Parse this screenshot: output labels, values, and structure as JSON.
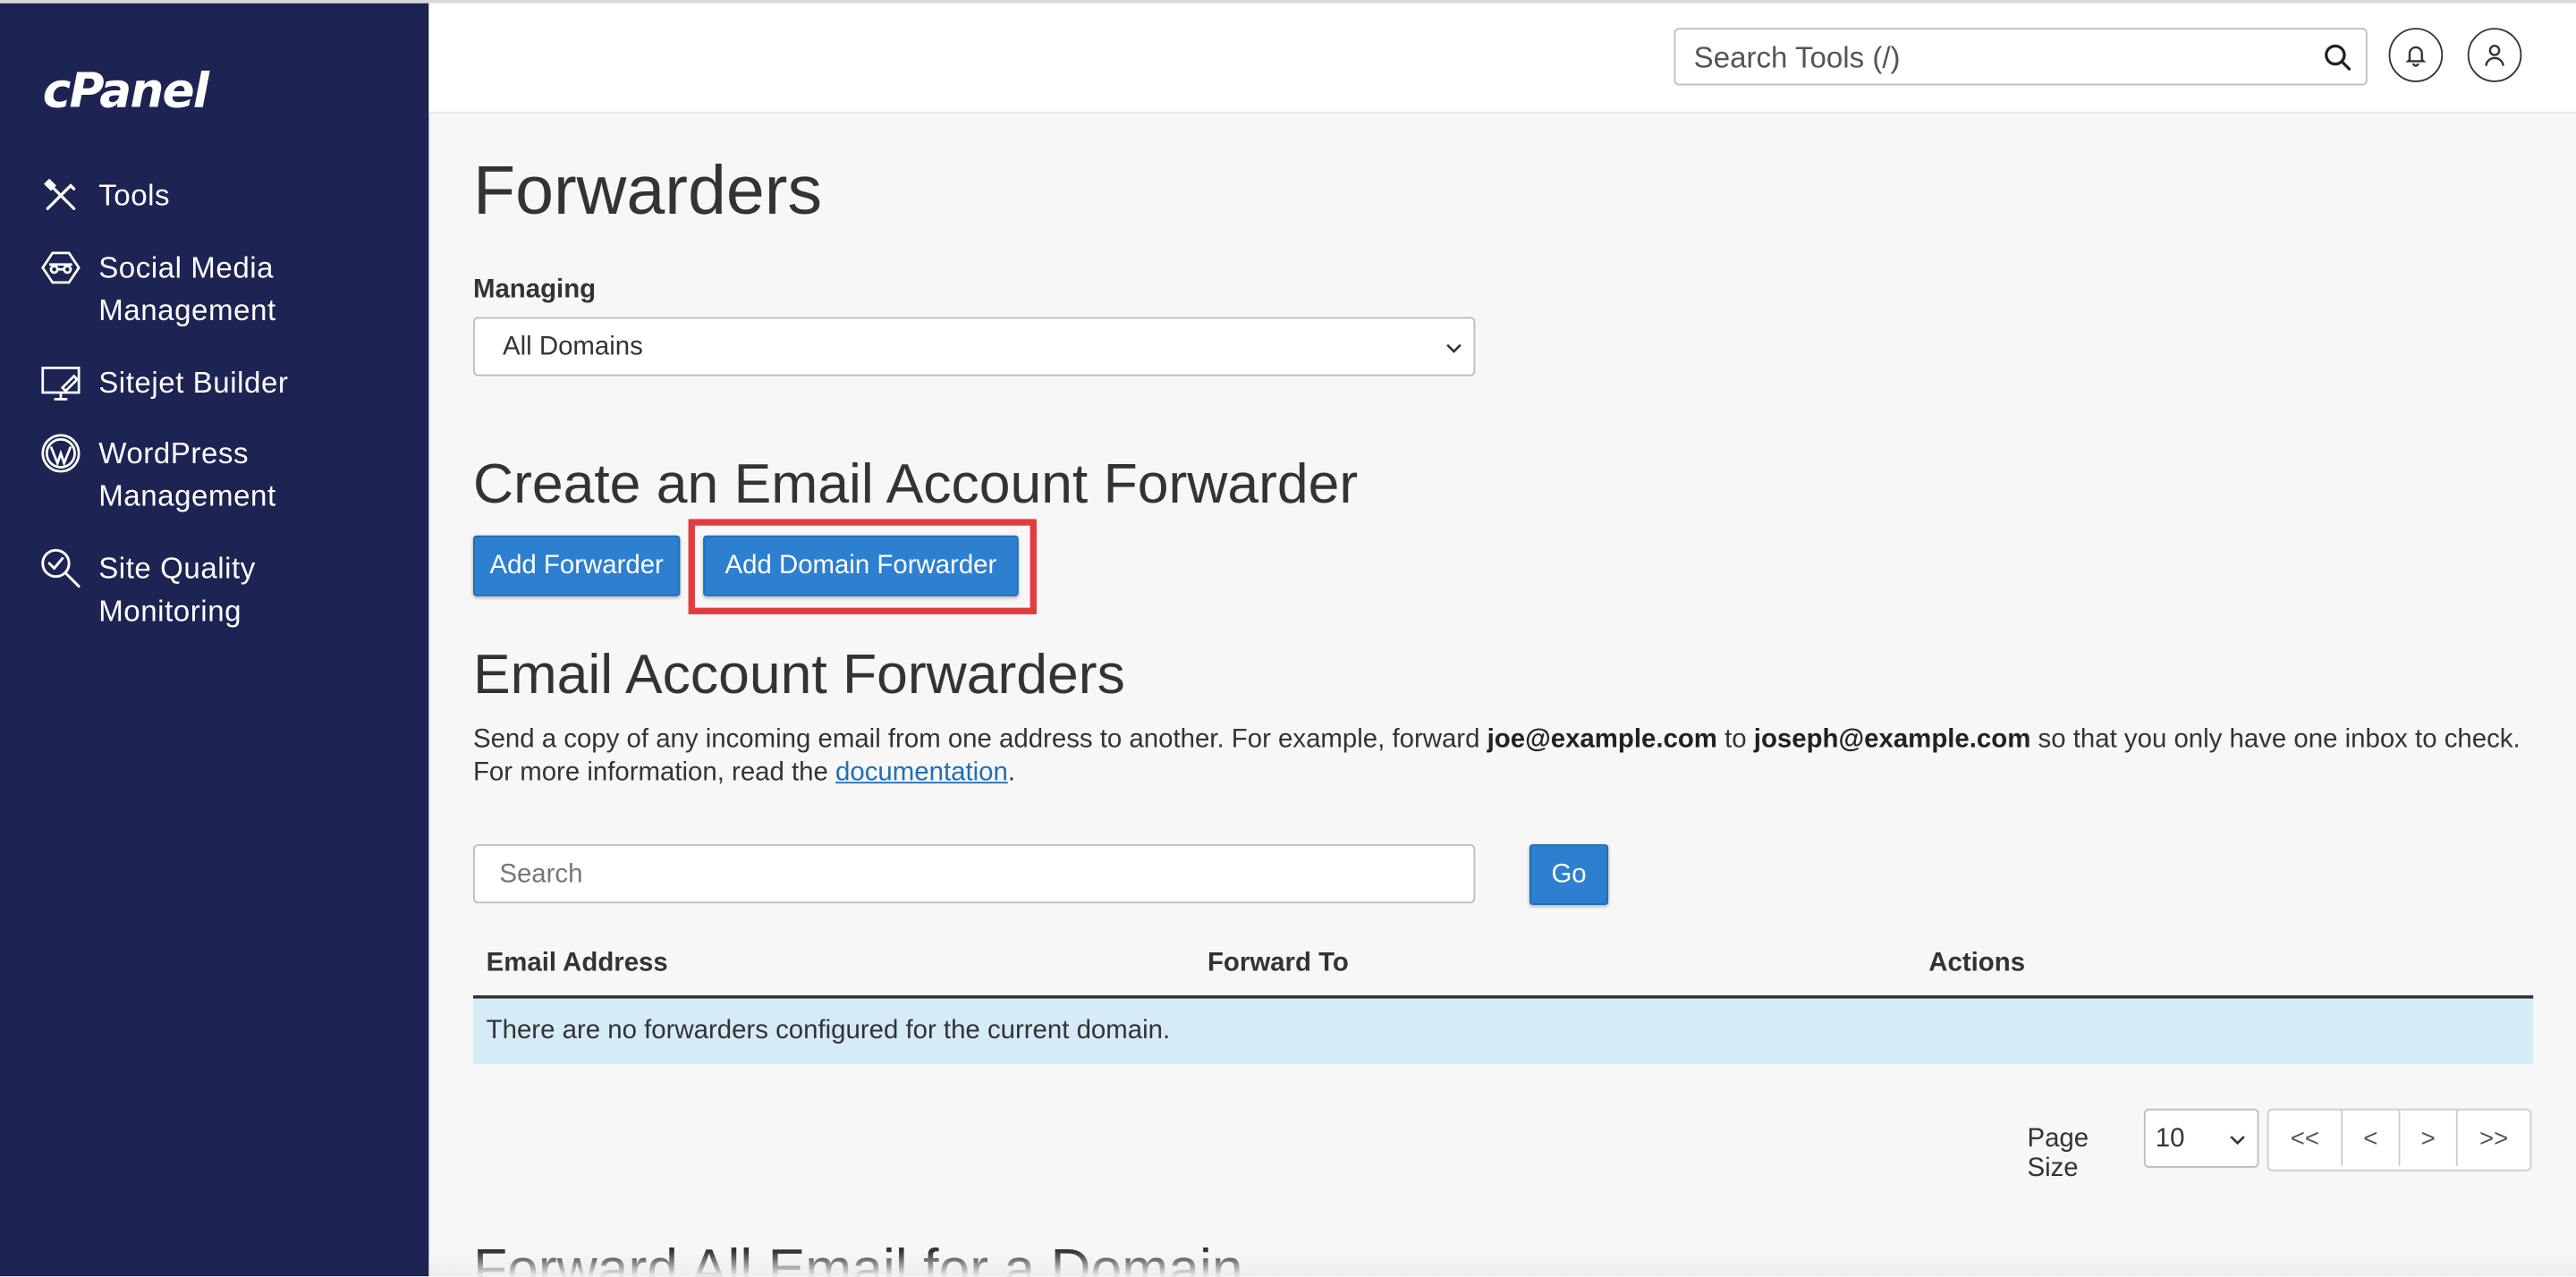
{
  "app": {
    "logo": "cPanel"
  },
  "sidebar": {
    "items": [
      {
        "label": "Tools",
        "icon": "tools-icon"
      },
      {
        "label": "Social Media\nManagement",
        "icon": "social-media-icon"
      },
      {
        "label": "Sitejet Builder",
        "icon": "sitejet-icon"
      },
      {
        "label": "WordPress\nManagement",
        "icon": "wordpress-icon"
      },
      {
        "label": "Site Quality\nMonitoring",
        "icon": "site-quality-icon"
      }
    ]
  },
  "header": {
    "search_placeholder": "Search Tools (/)",
    "notifications_icon": "bell-icon",
    "user_icon": "user-icon"
  },
  "page": {
    "title": "Forwarders",
    "managing_label": "Managing",
    "managing_value": "All Domains"
  },
  "create": {
    "heading": "Create an Email Account Forwarder",
    "add_forwarder": "Add Forwarder",
    "add_domain_forwarder": "Add Domain Forwarder"
  },
  "forwarders": {
    "heading": "Email Account Forwarders",
    "desc_1": "Send a copy of any incoming email from one address to another. For example, forward ",
    "desc_email1": "joe@example.com",
    "desc_2": " to ",
    "desc_email2": "joseph@example.com",
    "desc_3": " so that you only have one inbox to check.",
    "desc_4": "For more information, read the ",
    "desc_link": "documentation",
    "desc_5": ".",
    "search_placeholder": "Search",
    "go": "Go",
    "columns": [
      "Email Address",
      "Forward To",
      "Actions"
    ],
    "empty_message": "There are no forwarders configured for the current domain.",
    "page_size_label": "Page Size",
    "page_size": "10",
    "pager": [
      "<<",
      "<",
      ">",
      ">>"
    ]
  },
  "forward_all": {
    "heading": "Forward All Email for a Domain"
  },
  "colors": {
    "sidebar_bg": "#1d2353",
    "primary_button": "#2d7fd0",
    "highlight": "#e23c3f",
    "empty_row_bg": "#d6ebf8"
  }
}
